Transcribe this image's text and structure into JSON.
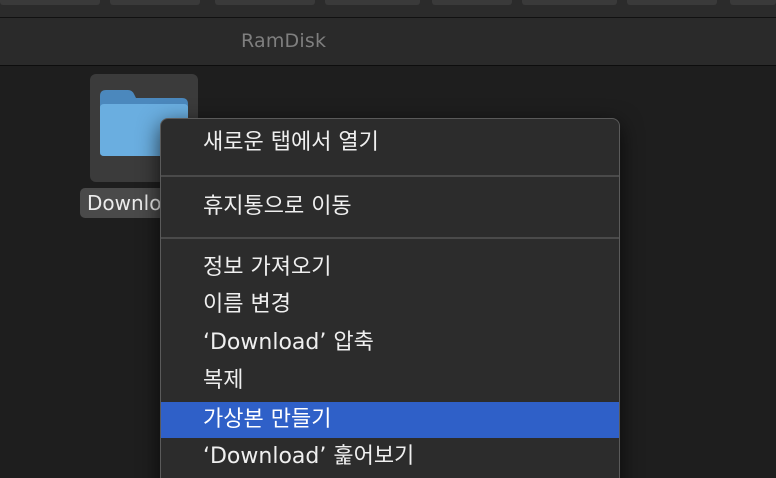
{
  "window": {
    "path_title": "RamDisk"
  },
  "folder": {
    "label": "Downlo",
    "icon": "folder-icon",
    "icon_color": "#6aaee0"
  },
  "context_menu": {
    "selected_color": "#2f60c8",
    "items": [
      {
        "label": "새로운 탭에서 열기"
      },
      {
        "label": "휴지통으로 이동"
      },
      {
        "label": "정보 가져오기"
      },
      {
        "label": "이름 변경"
      },
      {
        "label": "‘Download’ 압축"
      },
      {
        "label": "복제"
      },
      {
        "label": "가상본 만들기",
        "selected": true
      },
      {
        "label": "‘Download’ 훑어보기"
      }
    ]
  }
}
